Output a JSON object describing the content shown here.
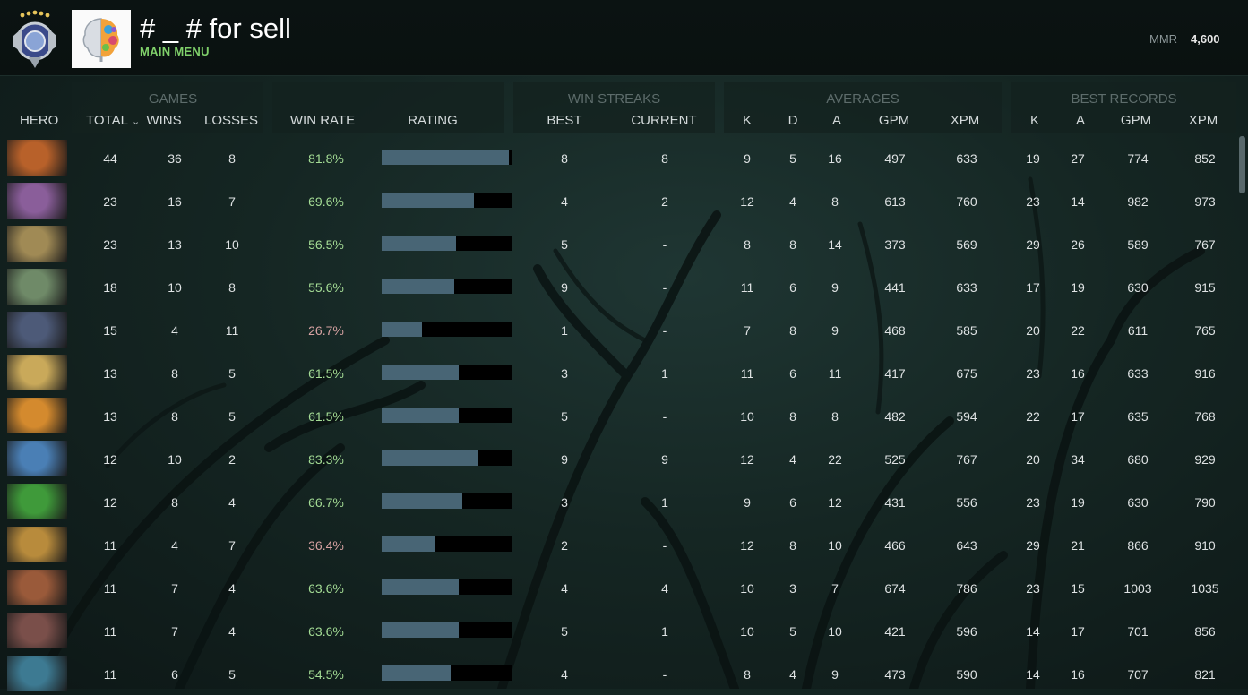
{
  "profile": {
    "name": "# _ # for sell",
    "main_menu": "MAIN MENU",
    "mmr_label": "MMR",
    "mmr_value": "4,600"
  },
  "groups": {
    "games": "GAMES",
    "win_streaks": "WIN STREAKS",
    "averages": "AVERAGES",
    "best_records": "BEST RECORDS"
  },
  "columns": {
    "hero": "HERO",
    "total": "TOTAL",
    "wins": "WINS",
    "losses": "LOSSES",
    "win_rate": "WIN RATE",
    "rating": "RATING",
    "best": "BEST",
    "current": "CURRENT",
    "avg_k": "K",
    "avg_d": "D",
    "avg_a": "A",
    "avg_gpm": "GPM",
    "avg_xpm": "XPM",
    "rec_k": "K",
    "rec_a": "A",
    "rec_gpm": "GPM",
    "rec_xpm": "XPM"
  },
  "colors": {
    "accent_green": "#7fd06a",
    "win_rate_good": "#a4dc95",
    "win_rate_bad": "#d8a3a3",
    "rating_bar": "#486575"
  },
  "rows": [
    {
      "total": "44",
      "wins": "36",
      "losses": "8",
      "win_rate": "81.8%",
      "rating": 0.98,
      "best": "8",
      "current": "8",
      "k": "9",
      "d": "5",
      "a": "16",
      "gpm": "497",
      "xpm": "633",
      "rk": "19",
      "ra": "27",
      "rgpm": "774",
      "rxpm": "852",
      "hero_color": "#b8612a"
    },
    {
      "total": "23",
      "wins": "16",
      "losses": "7",
      "win_rate": "69.6%",
      "rating": 0.71,
      "best": "4",
      "current": "2",
      "k": "12",
      "d": "4",
      "a": "8",
      "gpm": "613",
      "xpm": "760",
      "rk": "23",
      "ra": "14",
      "rgpm": "982",
      "rxpm": "973",
      "hero_color": "#8a5e9a"
    },
    {
      "total": "23",
      "wins": "13",
      "losses": "10",
      "win_rate": "56.5%",
      "rating": 0.57,
      "best": "5",
      "current": "-",
      "k": "8",
      "d": "8",
      "a": "14",
      "gpm": "373",
      "xpm": "569",
      "rk": "29",
      "ra": "26",
      "rgpm": "589",
      "rxpm": "767",
      "hero_color": "#a08a55"
    },
    {
      "total": "18",
      "wins": "10",
      "losses": "8",
      "win_rate": "55.6%",
      "rating": 0.56,
      "best": "9",
      "current": "-",
      "k": "11",
      "d": "6",
      "a": "9",
      "gpm": "441",
      "xpm": "633",
      "rk": "17",
      "ra": "19",
      "rgpm": "630",
      "rxpm": "915",
      "hero_color": "#6f8a68"
    },
    {
      "total": "15",
      "wins": "4",
      "losses": "11",
      "win_rate": "26.7%",
      "rating": 0.31,
      "best": "1",
      "current": "-",
      "k": "7",
      "d": "8",
      "a": "9",
      "gpm": "468",
      "xpm": "585",
      "rk": "20",
      "ra": "22",
      "rgpm": "611",
      "rxpm": "765",
      "hero_color": "#4d5a78"
    },
    {
      "total": "13",
      "wins": "8",
      "losses": "5",
      "win_rate": "61.5%",
      "rating": 0.59,
      "best": "3",
      "current": "1",
      "k": "11",
      "d": "6",
      "a": "11",
      "gpm": "417",
      "xpm": "675",
      "rk": "23",
      "ra": "16",
      "rgpm": "633",
      "rxpm": "916",
      "hero_color": "#c9a95a"
    },
    {
      "total": "13",
      "wins": "8",
      "losses": "5",
      "win_rate": "61.5%",
      "rating": 0.59,
      "best": "5",
      "current": "-",
      "k": "10",
      "d": "8",
      "a": "8",
      "gpm": "482",
      "xpm": "594",
      "rk": "22",
      "ra": "17",
      "rgpm": "635",
      "rxpm": "768",
      "hero_color": "#d48a2e"
    },
    {
      "total": "12",
      "wins": "10",
      "losses": "2",
      "win_rate": "83.3%",
      "rating": 0.74,
      "best": "9",
      "current": "9",
      "k": "12",
      "d": "4",
      "a": "22",
      "gpm": "525",
      "xpm": "767",
      "rk": "20",
      "ra": "34",
      "rgpm": "680",
      "rxpm": "929",
      "hero_color": "#4a7fb5"
    },
    {
      "total": "12",
      "wins": "8",
      "losses": "4",
      "win_rate": "66.7%",
      "rating": 0.62,
      "best": "3",
      "current": "1",
      "k": "9",
      "d": "6",
      "a": "12",
      "gpm": "431",
      "xpm": "556",
      "rk": "23",
      "ra": "19",
      "rgpm": "630",
      "rxpm": "790",
      "hero_color": "#3f9a3a"
    },
    {
      "total": "11",
      "wins": "4",
      "losses": "7",
      "win_rate": "36.4%",
      "rating": 0.41,
      "best": "2",
      "current": "-",
      "k": "12",
      "d": "8",
      "a": "10",
      "gpm": "466",
      "xpm": "643",
      "rk": "29",
      "ra": "21",
      "rgpm": "866",
      "rxpm": "910",
      "hero_color": "#b88b3c"
    },
    {
      "total": "11",
      "wins": "7",
      "losses": "4",
      "win_rate": "63.6%",
      "rating": 0.59,
      "best": "4",
      "current": "4",
      "k": "10",
      "d": "3",
      "a": "7",
      "gpm": "674",
      "xpm": "786",
      "rk": "23",
      "ra": "15",
      "rgpm": "1003",
      "rxpm": "1035",
      "hero_color": "#9a5a3a"
    },
    {
      "total": "11",
      "wins": "7",
      "losses": "4",
      "win_rate": "63.6%",
      "rating": 0.59,
      "best": "5",
      "current": "1",
      "k": "10",
      "d": "5",
      "a": "10",
      "gpm": "421",
      "xpm": "596",
      "rk": "14",
      "ra": "17",
      "rgpm": "701",
      "rxpm": "856",
      "hero_color": "#7a4f4a"
    },
    {
      "total": "11",
      "wins": "6",
      "losses": "5",
      "win_rate": "54.5%",
      "rating": 0.53,
      "best": "4",
      "current": "-",
      "k": "8",
      "d": "4",
      "a": "9",
      "gpm": "473",
      "xpm": "590",
      "rk": "14",
      "ra": "16",
      "rgpm": "707",
      "rxpm": "821",
      "hero_color": "#3d7a92"
    }
  ]
}
